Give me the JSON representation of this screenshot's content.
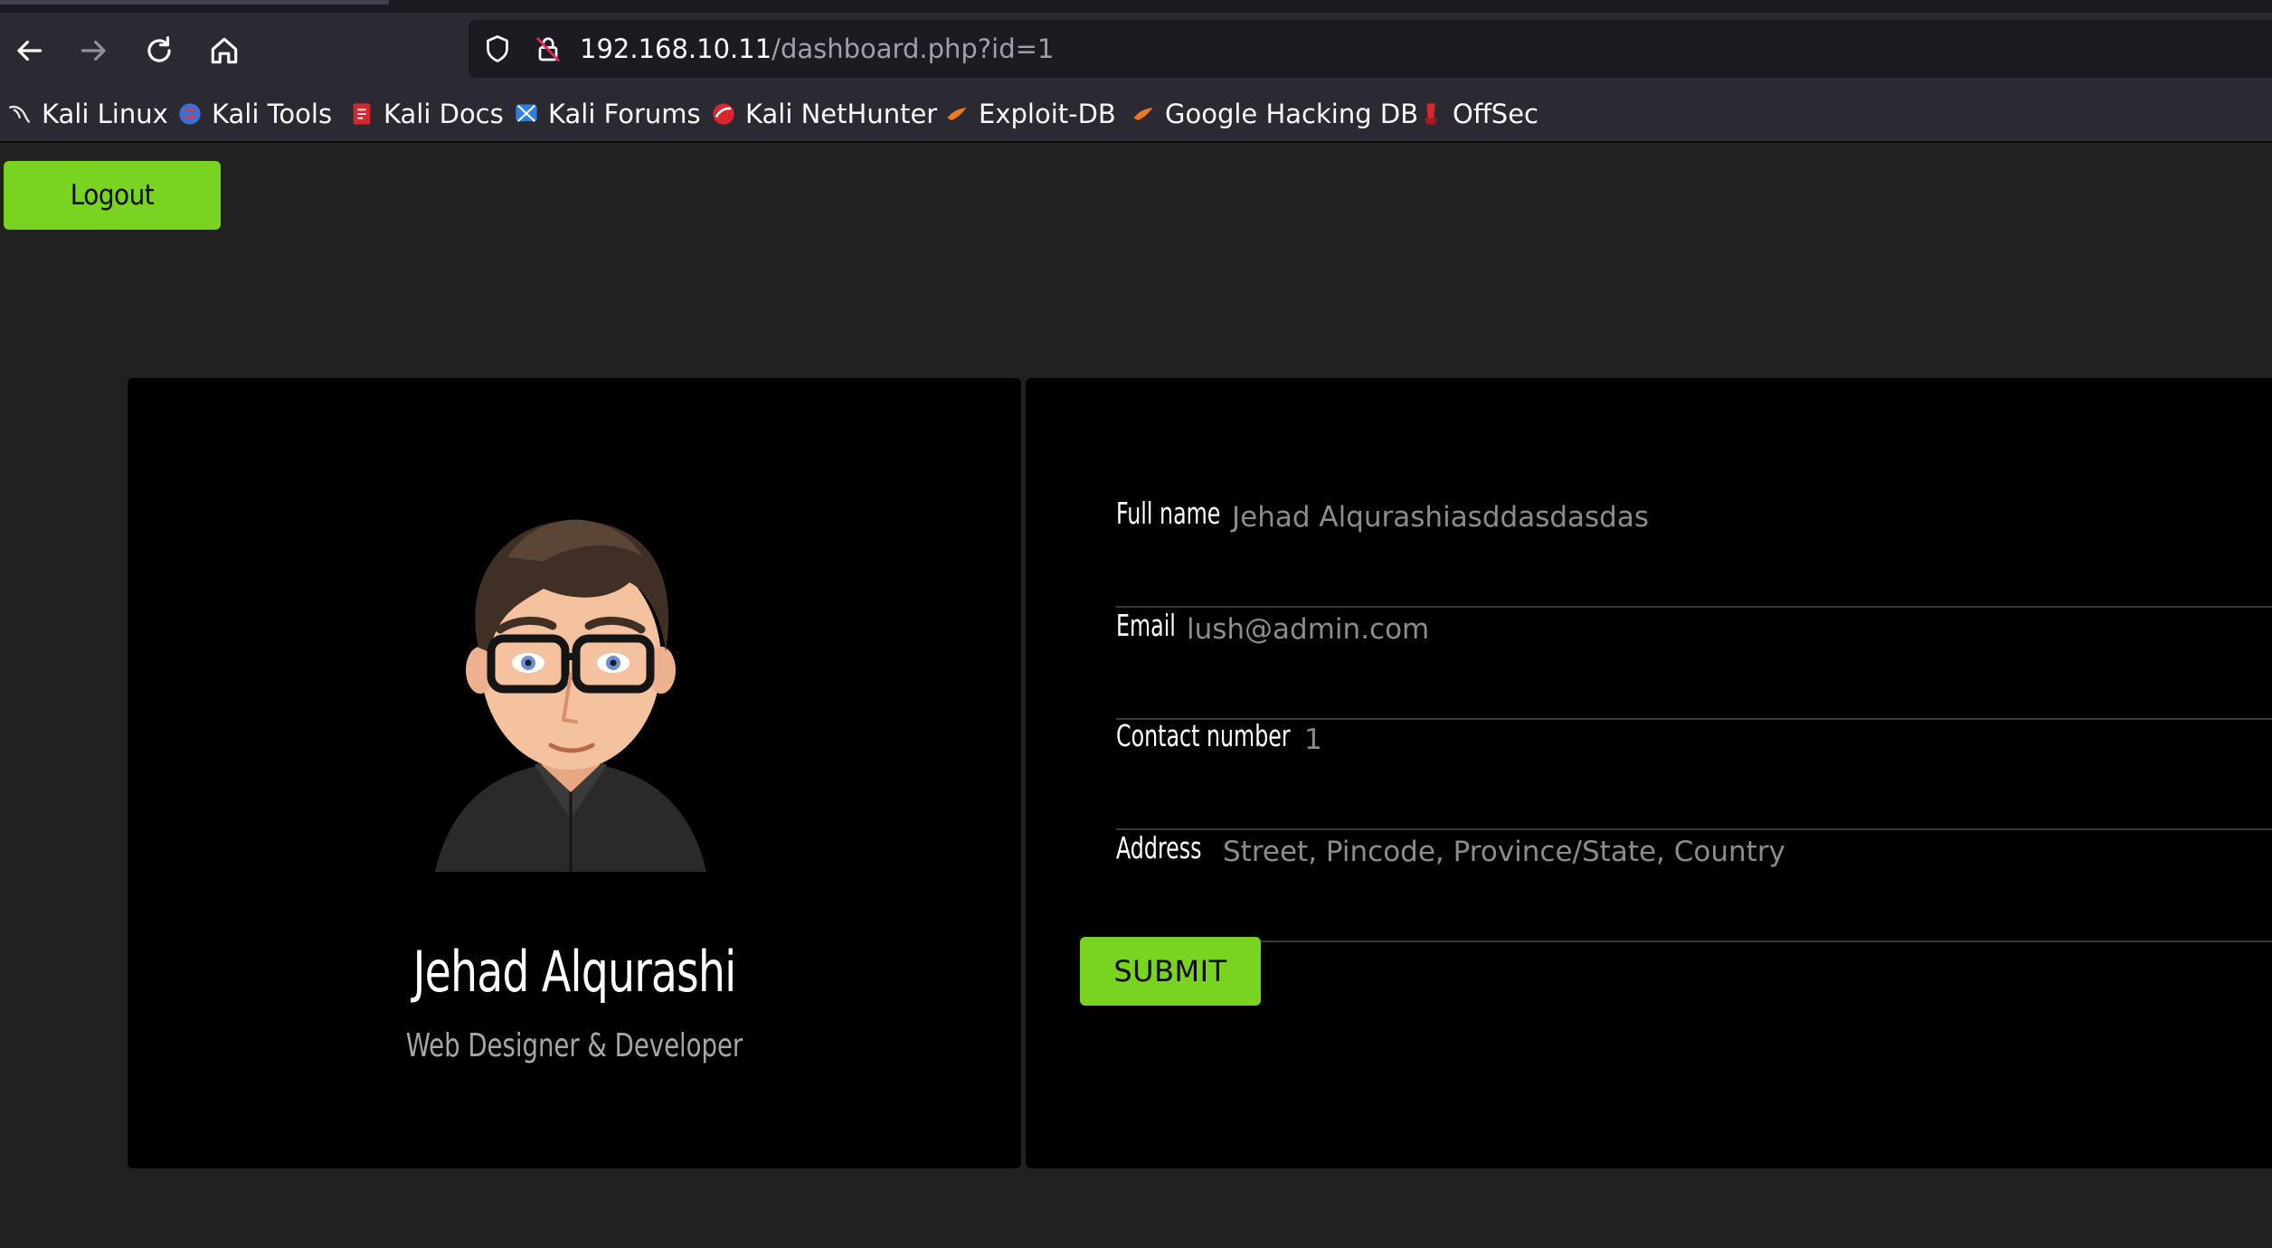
{
  "browser": {
    "url_host": "192.168.10.11",
    "url_path": "/dashboard.php?id=1",
    "icons": [
      "back-arrow-icon",
      "forward-arrow-icon",
      "reload-icon",
      "home-icon",
      "shield-icon",
      "insecure-lock-icon",
      "bookmark-star-icon"
    ]
  },
  "bookmarks": [
    {
      "label": "Kali Linux",
      "icon": "kali-dragon-icon"
    },
    {
      "label": "Kali Tools",
      "icon": "kali-tools-icon"
    },
    {
      "label": "Kali Docs",
      "icon": "kali-docs-icon"
    },
    {
      "label": "Kali Forums",
      "icon": "kali-forums-icon"
    },
    {
      "label": "Kali NetHunter",
      "icon": "nethunter-icon"
    },
    {
      "label": "Exploit-DB",
      "icon": "exploit-db-icon"
    },
    {
      "label": "Google Hacking DB",
      "icon": "ghdb-icon"
    },
    {
      "label": "OffSec",
      "icon": "offsec-icon"
    }
  ],
  "page": {
    "logout_label": "Logout",
    "profile": {
      "name": "Jehad Alqurashi",
      "role": "Web Designer & Developer"
    },
    "form": {
      "fields": [
        {
          "label": "Full name",
          "value": "Jehad Alqurashiasddasdasdas"
        },
        {
          "label": "Email",
          "value": "lush@admin.com"
        },
        {
          "label": "Contact number",
          "value": "1"
        },
        {
          "label": "Address",
          "value": "Street, Pincode, Province/State, Country"
        }
      ],
      "submit_label": "SUBMIT"
    }
  },
  "colors": {
    "accent_green": "#79d321",
    "page_bg": "#212121",
    "card_bg": "#000000",
    "browser_chrome": "#2b2a33"
  }
}
